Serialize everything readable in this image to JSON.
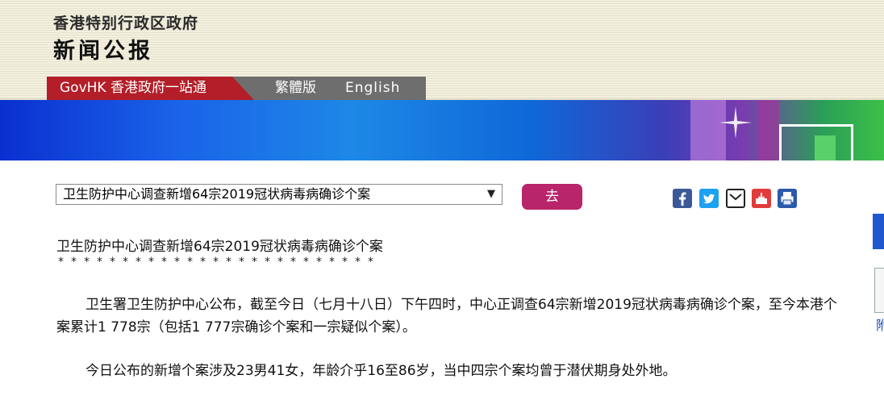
{
  "header": {
    "gov_name": "香港特别行政区政府",
    "site_name": "新闻公报"
  },
  "tabs": {
    "govhk": "GovHK 香港政府一站通",
    "traditional": "繁體版",
    "english": "English"
  },
  "controls": {
    "select_value": "卫生防护中心调查新增64宗2019冠状病毒病确诊个案",
    "go_label": "去"
  },
  "share_icons": [
    "facebook-icon",
    "twitter-icon",
    "email-icon",
    "weibo-icon",
    "print-icon"
  ],
  "article": {
    "title": "卫生防护中心调查新增64宗2019冠状病毒病确诊个案",
    "asterisks": "*************************",
    "paragraphs": [
      "卫生署卫生防护中心公布，截至今日（七月十八日）下午四时，中心正调查64宗新增2019冠状病毒病确诊个案，至今本港个案累计1 778宗（包括1 777宗确诊个案和一宗疑似个案）。",
      "今日公布的新增个案涉及23男41女，年龄介乎16至86岁，当中四宗个案均曾于潜伏期身处外地。"
    ]
  },
  "right_edge": {
    "partial_char": "附"
  },
  "colors": {
    "header_bg": "#f4f0de",
    "govhk_tab": "#b31e28",
    "lang_tab": "#6e6e6e",
    "go_button": "#b8256b"
  }
}
